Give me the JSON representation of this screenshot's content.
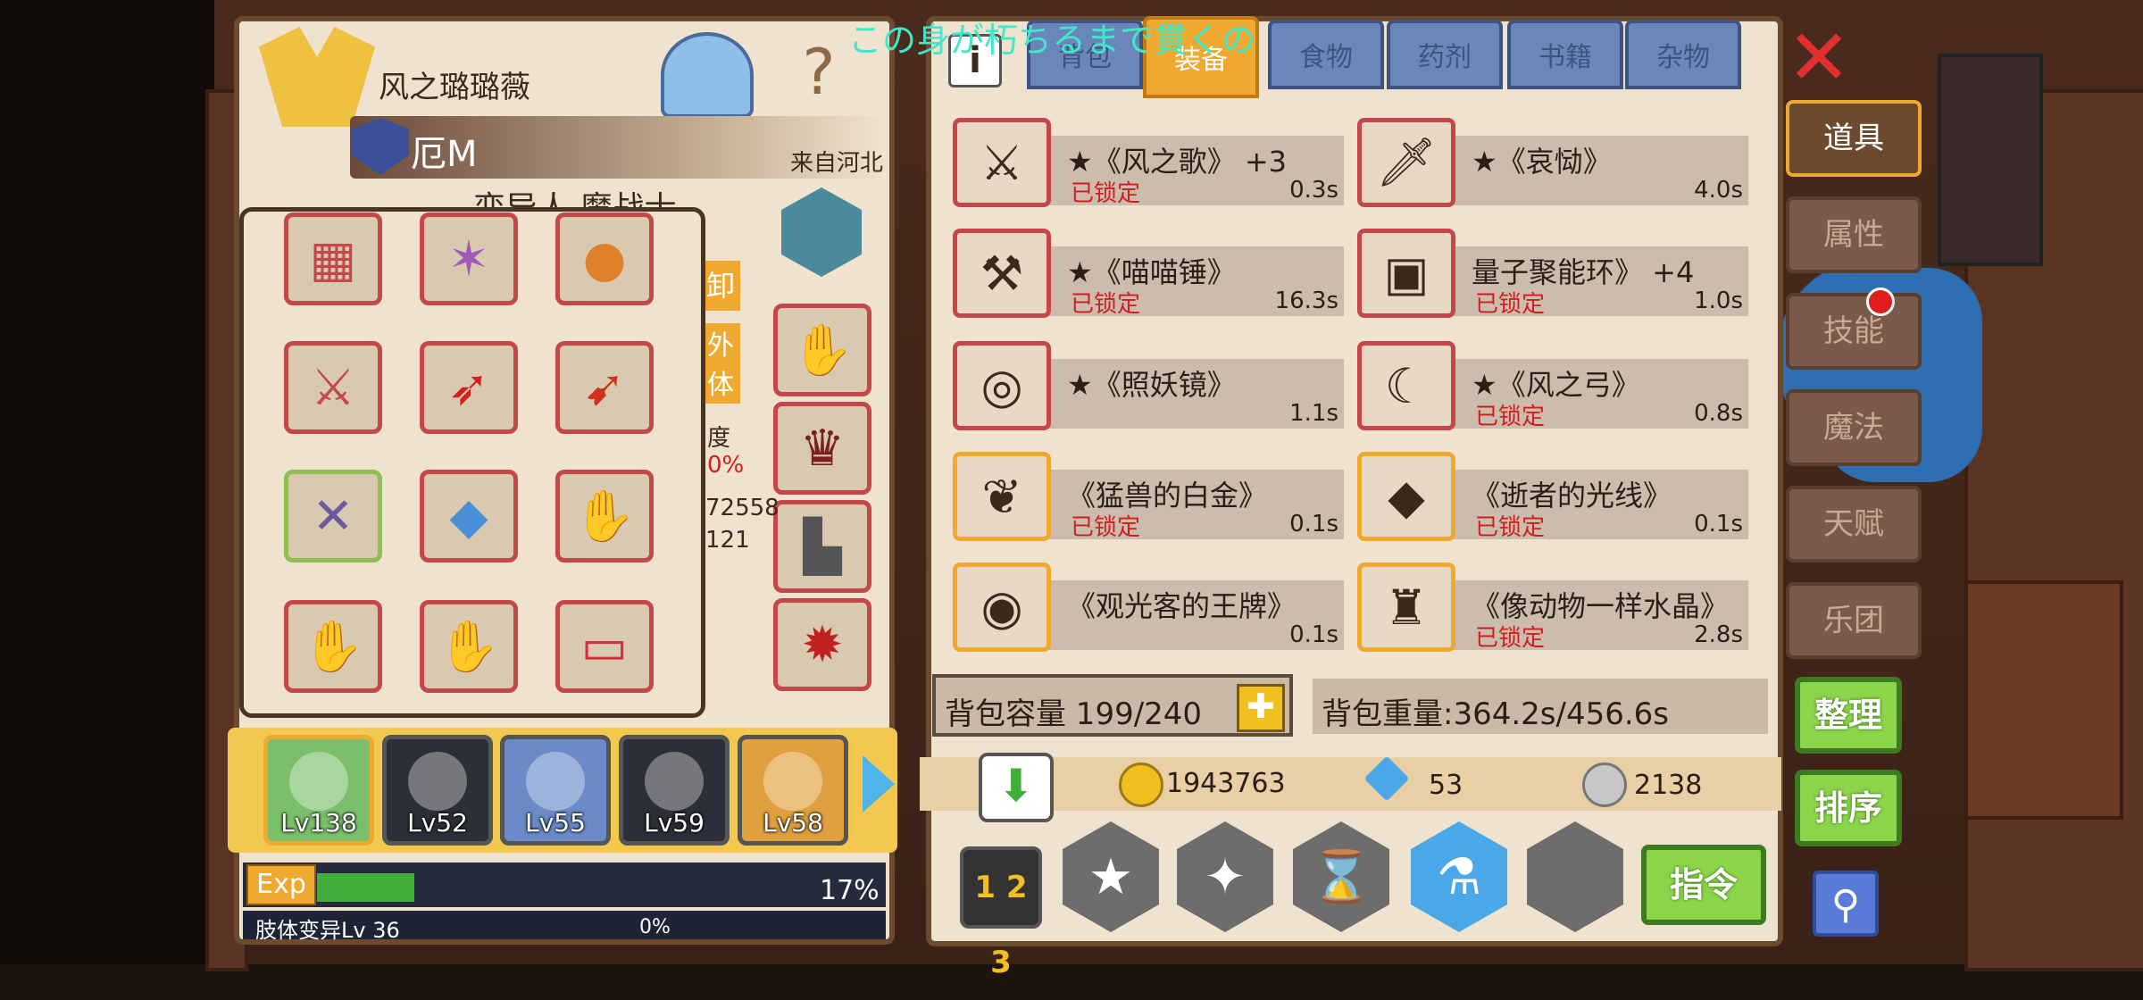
{
  "overlay_text": "この身が朽ちるまで貫くの",
  "character": {
    "name": "风之璐璐薇",
    "gender_icon": "male-symbol-icon",
    "class": "厄M",
    "origin": "来自河北",
    "race_partial": "变异人 魔战士",
    "side_texts": [
      "卸",
      "外\n体",
      "度",
      "0%",
      "72558",
      "121"
    ]
  },
  "equipment_slots": [
    {
      "icon": "treasure-chest-icon",
      "glyph": "▦",
      "color": "#c6474a"
    },
    {
      "icon": "dark-wings-icon",
      "glyph": "✶",
      "color": "#a05ab8"
    },
    {
      "icon": "pumpkin-icon",
      "glyph": "●",
      "color": "#e0802a"
    },
    {
      "icon": "dagger-icon",
      "glyph": "⚔",
      "color": "#c6474a"
    },
    {
      "icon": "red-crossbow-icon",
      "glyph": "➶",
      "color": "#d02020"
    },
    {
      "icon": "flame-spear-icon",
      "glyph": "➹",
      "color": "#d03020"
    },
    {
      "icon": "crossed-blades-icon",
      "glyph": "✕",
      "color": "#6a5aa0"
    },
    {
      "icon": "crystal-helmet-icon",
      "glyph": "◆",
      "color": "#4a8fd8"
    },
    {
      "icon": "gauntlet-icon",
      "glyph": "✋",
      "color": "#7a5ab0"
    },
    {
      "icon": "purple-glove-icon",
      "glyph": "✋",
      "color": "#7a5ab0"
    },
    {
      "icon": "purple-glove-icon",
      "glyph": "✋",
      "color": "#7a5ab0"
    },
    {
      "icon": "red-belt-icon",
      "glyph": "▭",
      "color": "#d03040"
    }
  ],
  "party": [
    {
      "level": "Lv138",
      "icon": "green-hair-girl-avatar"
    },
    {
      "level": "Lv52",
      "icon": "robot-avatar"
    },
    {
      "level": "Lv55",
      "icon": "maid-avatar"
    },
    {
      "level": "Lv59",
      "icon": "dark-figure-avatar"
    },
    {
      "level": "Lv58",
      "icon": "blonde-avatar"
    }
  ],
  "exp": {
    "label": "Exp",
    "percent_text": "17%",
    "fraction": 0.17
  },
  "sub_exp": {
    "label": "肢体变异Lv 36",
    "percent_text": "0%"
  },
  "tabs": [
    "背包",
    "装备",
    "食物",
    "药剂",
    "书籍",
    "杂物"
  ],
  "active_tab": "装备",
  "items": [
    {
      "name": "★《风之歌》 +3",
      "lock": "已锁定",
      "time": "0.3s",
      "icon": "wind-sword-icon",
      "glyph": "⚔",
      "border": "red"
    },
    {
      "name": "★《哀恸》",
      "lock": "",
      "time": "4.0s",
      "icon": "dark-dagger-icon",
      "glyph": "🗡",
      "border": "red"
    },
    {
      "name": "★《喵喵锤》",
      "lock": "已锁定",
      "time": "16.3s",
      "icon": "hammer-icon",
      "glyph": "⚒",
      "border": "red"
    },
    {
      "name": "量子聚能环》 +4",
      "lock": "已锁定",
      "time": "1.0s",
      "icon": "quantum-ring-icon",
      "glyph": "▣",
      "border": "red"
    },
    {
      "name": "★《照妖镜》",
      "lock": "",
      "time": "1.1s",
      "icon": "mirror-icon",
      "glyph": "◎",
      "border": "red"
    },
    {
      "name": "★《风之弓》",
      "lock": "已锁定",
      "time": "0.8s",
      "icon": "wind-bow-icon",
      "glyph": "☾",
      "border": "red"
    },
    {
      "name": "《猛兽的白金》",
      "lock": "已锁定",
      "time": "0.1s",
      "icon": "feather-icon",
      "glyph": "❦",
      "border": "gold"
    },
    {
      "name": "《逝者的光线》",
      "lock": "已锁定",
      "time": "0.1s",
      "icon": "green-gem-icon",
      "glyph": "◆",
      "border": "gold"
    },
    {
      "name": "《观光客的王牌》",
      "lock": "",
      "time": "0.1s",
      "icon": "card-charm-icon",
      "glyph": "◉",
      "border": "gold"
    },
    {
      "name": "《像动物一样水晶》",
      "lock": "已锁定",
      "time": "2.8s",
      "icon": "armor-vest-icon",
      "glyph": "♜",
      "border": "gold"
    }
  ],
  "backpack": {
    "capacity": "背包容量 199/240",
    "add_label": "✚",
    "weight": "背包重量:364.2s/456.6s"
  },
  "currency": {
    "gold": "1943763",
    "gems": "53",
    "silver": "2138"
  },
  "bottom_buttons": {
    "command": "指令",
    "sort": "整理",
    "order": "排序",
    "number_badge": "1 2 3"
  },
  "side_tabs": [
    "道具",
    "属性",
    "技能",
    "魔法",
    "天赋",
    "乐团"
  ],
  "active_side_tab": "道具",
  "colors": {
    "accent": "#f0a930",
    "lock_red": "#d01e1e",
    "green_btn": "#8cd44a"
  }
}
